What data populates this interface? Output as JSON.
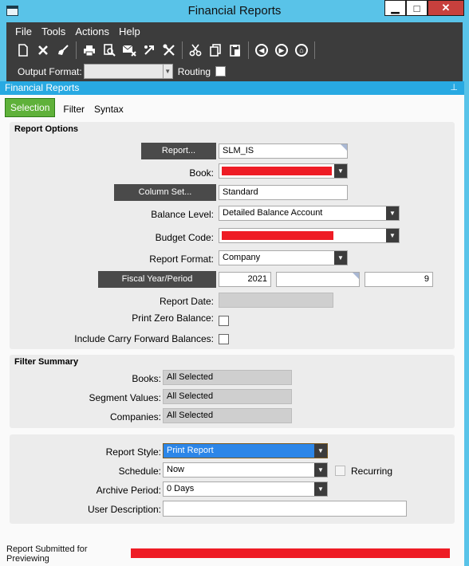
{
  "window": {
    "title": "Financial Reports",
    "min_label": "▁",
    "max_label": "□",
    "close_label": "✕"
  },
  "menu": [
    "File",
    "Tools",
    "Actions",
    "Help"
  ],
  "toolbar": {
    "icons": [
      "new-document-icon",
      "delete-icon",
      "clear-broom-icon",
      "print-icon",
      "print-preview-icon",
      "email-icon",
      "export-icon",
      "tools-icon",
      "cut-icon",
      "copy-icon",
      "paste-icon",
      "back-icon",
      "forward-icon",
      "home-icon"
    ]
  },
  "options": {
    "output_format_label": "Output Format:",
    "output_format_value": "",
    "routing_label": "Routing"
  },
  "panel": {
    "title": "Financial Reports",
    "pin_glyph": "⊥"
  },
  "tabs": [
    {
      "label": "Selection",
      "active": true
    },
    {
      "label": "Filter",
      "active": false
    },
    {
      "label": "Syntax",
      "active": false
    }
  ],
  "report_options": {
    "title": "Report Options",
    "report_button": "Report...",
    "report_value": "SLM_IS",
    "book_label": "Book:",
    "column_set_button": "Column Set...",
    "column_set_value": "Standard",
    "balance_level_label": "Balance Level:",
    "balance_level_value": "Detailed Balance Account",
    "budget_code_label": "Budget Code:",
    "report_format_label": "Report Format:",
    "report_format_value": "Company",
    "fiscal_button": "Fiscal Year/Period",
    "fiscal_year": "2021",
    "fiscal_middle": "",
    "fiscal_period": "9",
    "report_date_label": "Report Date:",
    "print_zero_label": "Print Zero Balance:",
    "carry_forward_label": "Include Carry Forward Balances:"
  },
  "filter_summary": {
    "title": "Filter Summary",
    "books_label": "Books:",
    "books_value": "All Selected",
    "segment_label": "Segment Values:",
    "segment_value": "All Selected",
    "companies_label": "Companies:",
    "companies_value": "All Selected"
  },
  "report_style": {
    "style_label": "Report Style:",
    "style_value": "Print Report",
    "schedule_label": "Schedule:",
    "schedule_value": "Now",
    "recurring_label": "Recurring",
    "archive_label": "Archive Period:",
    "archive_value": "0 Days",
    "user_desc_label": "User Description:",
    "user_desc_value": ""
  },
  "footer": {
    "line1": "Report Submitted for",
    "line2": "Previewing"
  },
  "colors": {
    "title_bar": "#59c3e8",
    "menu_bg": "#3c3c3c",
    "panel_head": "#28a9e2",
    "tab_active": "#5fb13a",
    "redacted": "#ee1c25",
    "selected_field": "#2c86e8"
  }
}
